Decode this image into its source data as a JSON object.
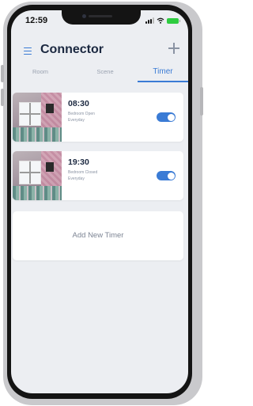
{
  "status_bar": {
    "time": "12:59"
  },
  "header": {
    "title": "Connector"
  },
  "tabs": [
    {
      "label": "Room",
      "active": false
    },
    {
      "label": "Scene",
      "active": false
    },
    {
      "label": "Timer",
      "active": true
    }
  ],
  "timers": [
    {
      "time": "08:30",
      "name": "Bedroom Open",
      "repeat": "Everyday",
      "enabled": true
    },
    {
      "time": "19:30",
      "name": "Bedroom Closed",
      "repeat": "Everyday",
      "enabled": true
    }
  ],
  "add_timer": {
    "label": "Add New Timer"
  },
  "colors": {
    "accent": "#3a7bd5",
    "background": "#eceef2",
    "title": "#1b2840"
  },
  "icons": [
    "menu-icon",
    "plus-icon",
    "signal-icon",
    "wifi-icon",
    "battery-icon"
  ]
}
